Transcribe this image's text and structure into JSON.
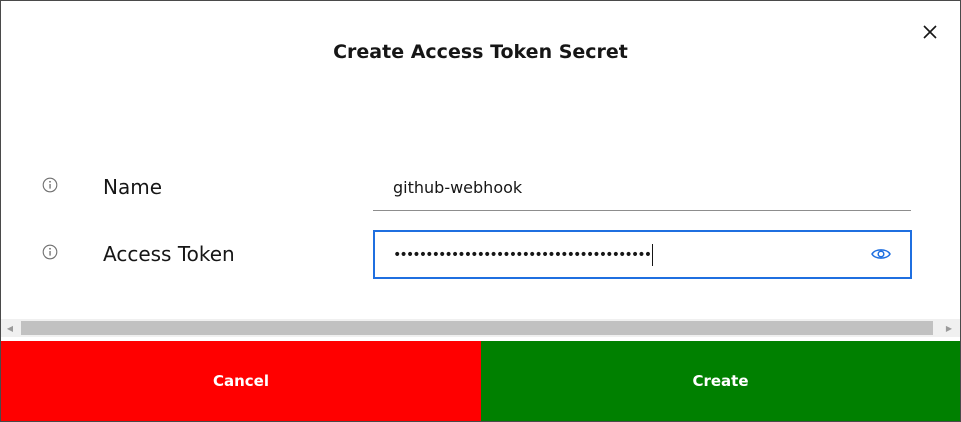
{
  "dialog": {
    "title": "Create Access Token Secret",
    "close_icon": "close-icon"
  },
  "form": {
    "name": {
      "label": "Name",
      "value": "github-webhook",
      "info_icon": "info-icon"
    },
    "access_token": {
      "label": "Access Token",
      "masked_value": "••••••••••••••••••••••••••••••••••••••••",
      "info_icon": "info-icon",
      "toggle_icon": "eye-icon"
    }
  },
  "actions": {
    "cancel_label": "Cancel",
    "create_label": "Create"
  },
  "colors": {
    "cancel": "#ff0000",
    "create": "#008000",
    "focus": "#1f6fe0"
  }
}
